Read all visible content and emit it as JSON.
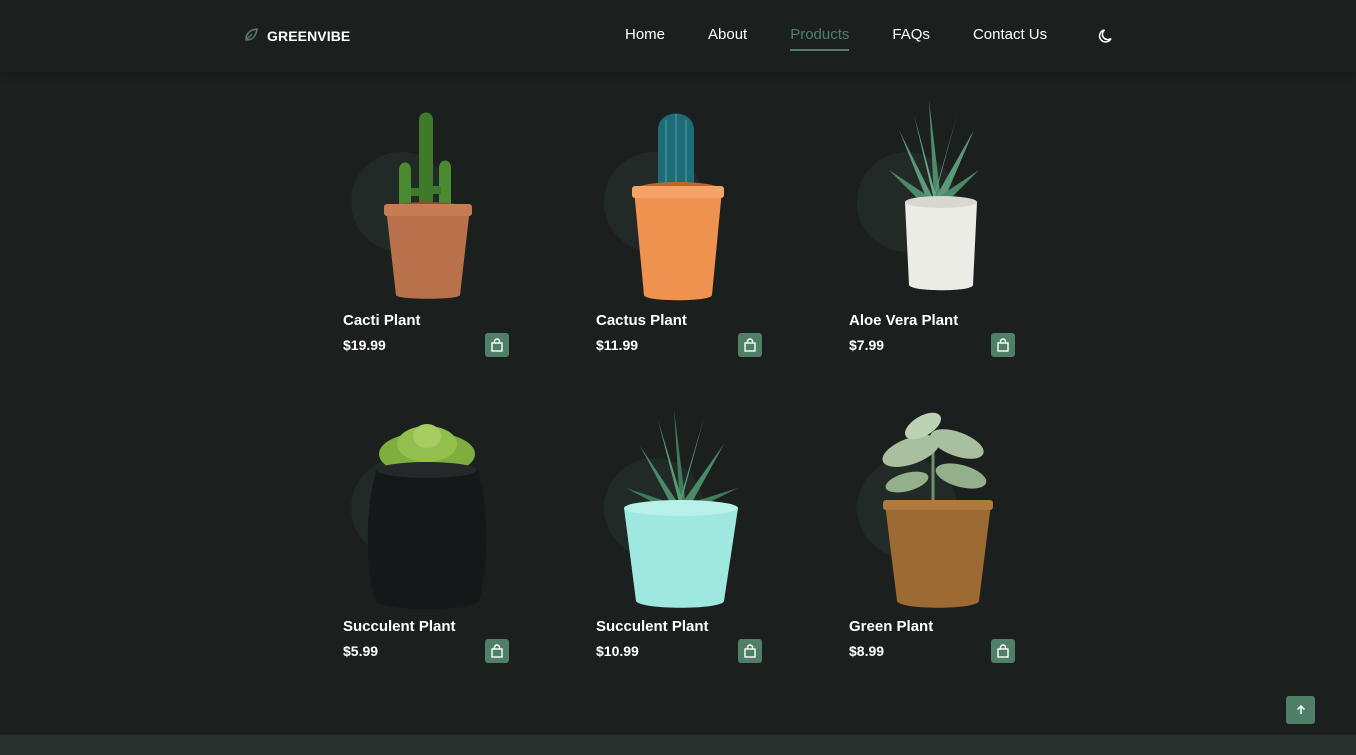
{
  "header": {
    "brand": "GREENVIBE",
    "logo_icon": "leaf-icon",
    "nav": [
      {
        "label": "Home",
        "active": false
      },
      {
        "label": "About",
        "active": false
      },
      {
        "label": "Products",
        "active": true
      },
      {
        "label": "FAQs",
        "active": false
      },
      {
        "label": "Contact Us",
        "active": false
      }
    ],
    "theme_icon": "moon-icon"
  },
  "products": [
    {
      "name": "Cacti Plant",
      "price": "$19.99",
      "pot_color": "#b8714a",
      "plant": "cactus-green"
    },
    {
      "name": "Cactus Plant",
      "price": "$11.99",
      "pot_color": "#f0924f",
      "plant": "cactus-blue"
    },
    {
      "name": "Aloe Vera Plant",
      "price": "$7.99",
      "pot_color": "#ecece6",
      "plant": "aloe"
    },
    {
      "name": "Succulent Plant",
      "price": "$5.99",
      "pot_color": "#151818",
      "plant": "succulent-rosette"
    },
    {
      "name": "Succulent Plant",
      "price": "$10.99",
      "pot_color": "#9ee8e0",
      "plant": "haworthia"
    },
    {
      "name": "Green Plant",
      "price": "$8.99",
      "pot_color": "#9c6a32",
      "plant": "leafy"
    }
  ],
  "colors": {
    "background": "#1b201f",
    "accent": "#4f7f66",
    "footer": "#2a302e"
  },
  "icons": {
    "cart": "shopping-bag-icon",
    "scroll_top": "arrow-up-icon"
  }
}
